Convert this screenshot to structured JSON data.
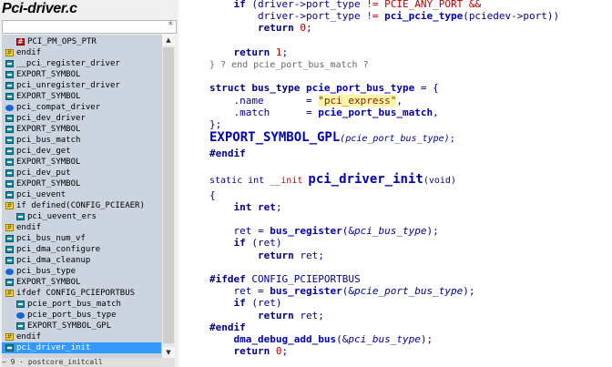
{
  "window": {
    "file_title": "Pci-driver.c",
    "filter_symbol": "*"
  },
  "symbols": [
    {
      "icon": "red-hash-icon",
      "label": "PCI_PM_OPS_PTR",
      "indent": 1
    },
    {
      "icon": "preprocessor-icon",
      "label": "endif",
      "indent": 0
    },
    {
      "icon": "define-icon",
      "label": "__pci_register_driver",
      "indent": 0
    },
    {
      "icon": "define-icon",
      "label": "EXPORT_SYMBOL",
      "indent": 0
    },
    {
      "icon": "define-icon",
      "label": "pci_unregister_driver",
      "indent": 0
    },
    {
      "icon": "define-icon",
      "label": "EXPORT_SYMBOL",
      "indent": 0
    },
    {
      "icon": "function-icon",
      "label": "pci_compat_driver",
      "indent": 0
    },
    {
      "icon": "define-icon",
      "label": "pci_dev_driver",
      "indent": 0
    },
    {
      "icon": "define-icon",
      "label": "EXPORT_SYMBOL",
      "indent": 0
    },
    {
      "icon": "define-icon",
      "label": "pci_bus_match",
      "indent": 0
    },
    {
      "icon": "define-icon",
      "label": "pci_dev_get",
      "indent": 0
    },
    {
      "icon": "define-icon",
      "label": "EXPORT_SYMBOL",
      "indent": 0
    },
    {
      "icon": "define-icon",
      "label": "pci_dev_put",
      "indent": 0
    },
    {
      "icon": "define-icon",
      "label": "EXPORT_SYMBOL",
      "indent": 0
    },
    {
      "icon": "define-icon",
      "label": "pci_uevent",
      "indent": 0
    },
    {
      "icon": "preprocessor-icon",
      "label": "if defined(CONFIG_PCIEAER)",
      "indent": 0
    },
    {
      "icon": "define-icon",
      "label": "pci_uevent_ers",
      "indent": 1
    },
    {
      "icon": "preprocessor-icon",
      "label": "endif",
      "indent": 0
    },
    {
      "icon": "define-icon",
      "label": "pci_bus_num_vf",
      "indent": 0
    },
    {
      "icon": "define-icon",
      "label": "pci_dma_configure",
      "indent": 0
    },
    {
      "icon": "define-icon",
      "label": "pci_dma_cleanup",
      "indent": 0
    },
    {
      "icon": "function-icon",
      "label": "pci_bus_type",
      "indent": 0
    },
    {
      "icon": "define-icon",
      "label": "EXPORT_SYMBOL",
      "indent": 0
    },
    {
      "icon": "preprocessor-icon",
      "label": "ifdef CONFIG_PCIEPORTBUS",
      "indent": 0
    },
    {
      "icon": "define-icon",
      "label": "pcie_port_bus_match",
      "indent": 1
    },
    {
      "icon": "function-icon",
      "label": "pcie_port_bus_type",
      "indent": 1
    },
    {
      "icon": "define-icon",
      "label": "EXPORT_SYMBOL_GPL",
      "indent": 1
    },
    {
      "icon": "preprocessor-icon",
      "label": "endif",
      "indent": 0
    },
    {
      "icon": "define-icon",
      "label": "pci_driver_init",
      "indent": 0,
      "selected": true
    }
  ],
  "bottom_strip": "— 9 · postcore_initcall",
  "code_lines": [
    {
      "parts": [
        [
          "",
          "    "
        ],
        [
          "kw",
          "if"
        ],
        [
          "id",
          " ("
        ],
        [
          "id",
          "driver"
        ],
        [
          "id",
          "->"
        ],
        [
          "id",
          "port_type"
        ],
        [
          "red",
          " != "
        ],
        [
          "red",
          "PCIE_ANY_PORT"
        ],
        [
          "red",
          " &&"
        ]
      ]
    },
    {
      "parts": [
        [
          "",
          "        "
        ],
        [
          "id",
          "driver"
        ],
        [
          "id",
          "->"
        ],
        [
          "id",
          "port_type"
        ],
        [
          "red",
          " != "
        ],
        [
          "fn2",
          "pci_pcie_type"
        ],
        [
          "id",
          "("
        ],
        [
          "id",
          "pciedev"
        ],
        [
          "id",
          "->"
        ],
        [
          "id",
          "port"
        ],
        [
          "id",
          "))"
        ]
      ]
    },
    {
      "parts": [
        [
          "",
          "        "
        ],
        [
          "kw",
          "return"
        ],
        [
          "id",
          " "
        ],
        [
          "num",
          "0"
        ],
        [
          "id",
          ";"
        ]
      ]
    },
    {
      "parts": [
        [
          "",
          ""
        ]
      ]
    },
    {
      "parts": [
        [
          "",
          "    "
        ],
        [
          "kw",
          "return"
        ],
        [
          "id",
          " "
        ],
        [
          "num",
          "1"
        ],
        [
          "id",
          ";"
        ]
      ]
    },
    {
      "parts": [
        [
          "cmt",
          "} ? end pcie_port_bus_match ?"
        ]
      ]
    },
    {
      "parts": [
        [
          "",
          ""
        ]
      ]
    },
    {
      "parts": [
        [
          "kw",
          "struct"
        ],
        [
          "id",
          " "
        ],
        [
          "kw",
          "bus_type"
        ],
        [
          "id",
          " "
        ],
        [
          "fn2",
          "pcie_port_bus_type"
        ],
        [
          "id",
          " = {"
        ]
      ]
    },
    {
      "parts": [
        [
          "",
          "    "
        ],
        [
          "id",
          ".name"
        ],
        [
          "id",
          "       = "
        ],
        [
          "str",
          "\"pci_express\""
        ],
        [
          "id",
          ","
        ]
      ]
    },
    {
      "parts": [
        [
          "",
          "    "
        ],
        [
          "id",
          ".match"
        ],
        [
          "id",
          "      = "
        ],
        [
          "fn2",
          "pcie_port_bus_match"
        ],
        [
          "id",
          ","
        ]
      ]
    },
    {
      "parts": [
        [
          "id",
          "};"
        ]
      ]
    },
    {
      "big": true,
      "parts": [
        [
          "fn2",
          "EXPORT_SYMBOL_GPL"
        ],
        [
          "ital tiny",
          "(pcie_port_bus_type)"
        ],
        [
          "id tiny",
          ";"
        ]
      ]
    },
    {
      "parts": [
        [
          "pp2",
          "#endif"
        ]
      ]
    },
    {
      "parts": [
        [
          "",
          ""
        ]
      ]
    },
    {
      "big": true,
      "parts": [
        [
          "id tiny",
          "static int "
        ],
        [
          "red tiny",
          "__init "
        ],
        [
          "fn2",
          "pci_driver_init"
        ],
        [
          "id tiny",
          "(void)"
        ]
      ]
    },
    {
      "parts": [
        [
          "id",
          "{"
        ]
      ]
    },
    {
      "parts": [
        [
          "",
          "    "
        ],
        [
          "kw",
          "int"
        ],
        [
          "id",
          " "
        ],
        [
          "fn2",
          "ret"
        ],
        [
          "id",
          ";"
        ]
      ]
    },
    {
      "parts": [
        [
          "",
          ""
        ]
      ]
    },
    {
      "parts": [
        [
          "",
          "    "
        ],
        [
          "id",
          "ret = "
        ],
        [
          "fn2",
          "bus_register"
        ],
        [
          "id",
          "(&"
        ],
        [
          "ital",
          "pci_bus_type"
        ],
        [
          "id",
          ");"
        ]
      ]
    },
    {
      "parts": [
        [
          "",
          "    "
        ],
        [
          "kw",
          "if"
        ],
        [
          "id",
          " (ret)"
        ]
      ]
    },
    {
      "parts": [
        [
          "",
          "        "
        ],
        [
          "kw",
          "return"
        ],
        [
          "id",
          " ret;"
        ]
      ]
    },
    {
      "parts": [
        [
          "",
          ""
        ]
      ]
    },
    {
      "parts": [
        [
          "pp2",
          "#ifdef"
        ],
        [
          "id",
          " CONFIG_PCIEPORTBUS"
        ]
      ]
    },
    {
      "parts": [
        [
          "",
          "    "
        ],
        [
          "id",
          "ret = "
        ],
        [
          "fn2",
          "bus_register"
        ],
        [
          "id",
          "(&"
        ],
        [
          "ital",
          "pcie_port_bus_type"
        ],
        [
          "id",
          ");"
        ]
      ]
    },
    {
      "parts": [
        [
          "",
          "    "
        ],
        [
          "kw",
          "if"
        ],
        [
          "id",
          " (ret)"
        ]
      ]
    },
    {
      "parts": [
        [
          "",
          "        "
        ],
        [
          "kw",
          "return"
        ],
        [
          "id",
          " ret;"
        ]
      ]
    },
    {
      "parts": [
        [
          "pp2",
          "#endif"
        ]
      ]
    },
    {
      "parts": [
        [
          "",
          "    "
        ],
        [
          "fn2",
          "dma_debug_add_bus"
        ],
        [
          "id",
          "(&"
        ],
        [
          "ital",
          "pci_bus_type"
        ],
        [
          "id",
          ");"
        ]
      ]
    },
    {
      "parts": [
        [
          "",
          "    "
        ],
        [
          "kw",
          "return"
        ],
        [
          "id",
          " "
        ],
        [
          "num",
          "0"
        ],
        [
          "id",
          ";"
        ]
      ]
    }
  ]
}
